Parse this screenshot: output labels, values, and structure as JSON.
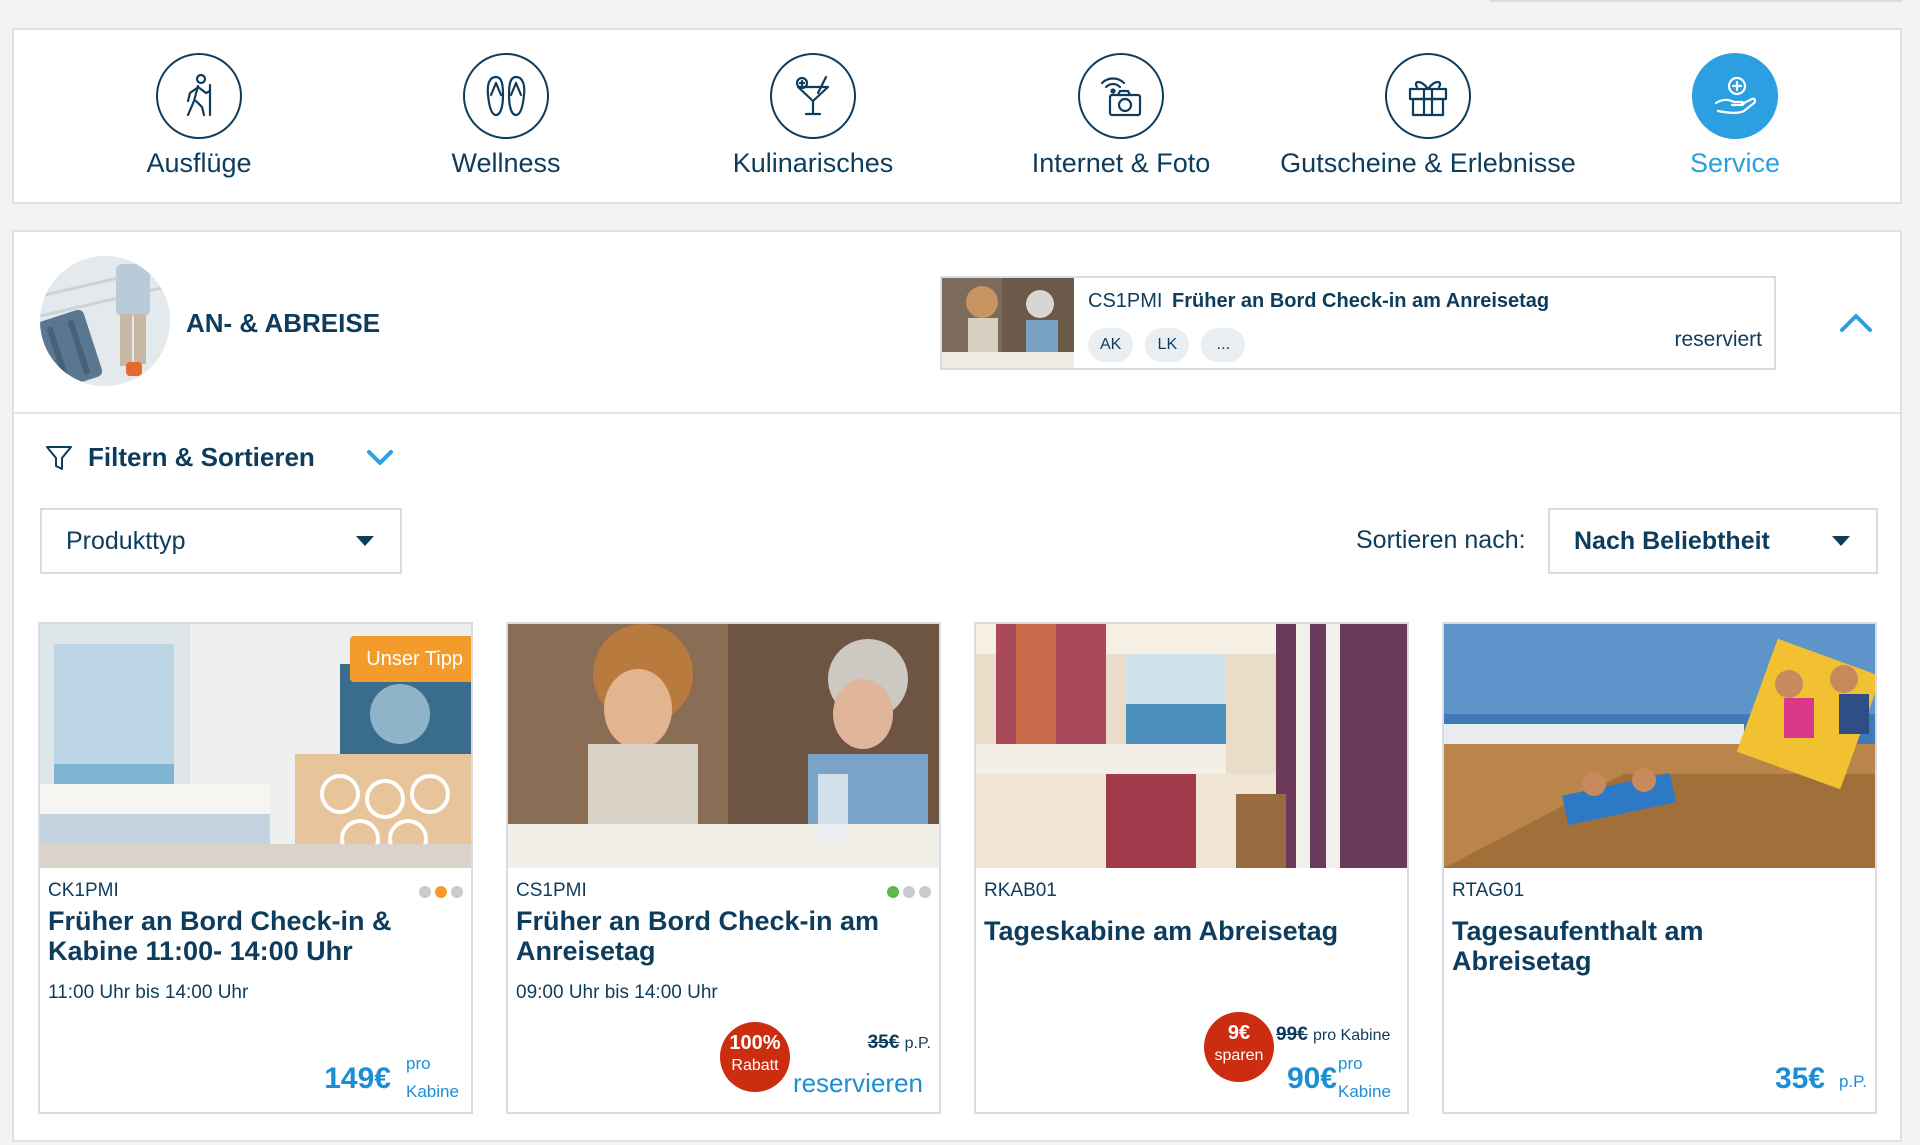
{
  "categories": [
    {
      "label": "Ausflüge",
      "icon": "hiker-icon",
      "active": false
    },
    {
      "label": "Wellness",
      "icon": "flip-flops-icon",
      "active": false
    },
    {
      "label": "Kulinarisches",
      "icon": "cocktail-icon",
      "active": false
    },
    {
      "label": "Internet & Foto",
      "icon": "wifi-camera-icon",
      "active": false
    },
    {
      "label": "Gutscheine & Erlebnisse",
      "icon": "gift-icon",
      "active": false
    },
    {
      "label": "Service",
      "icon": "hand-plus-icon",
      "active": true
    }
  ],
  "section": {
    "title": "AN- & ABREISE",
    "booked": {
      "code": "CS1PMI",
      "name": "Früher an Bord Check-in am Anreisetag",
      "tags": [
        "AK",
        "LK",
        "..."
      ],
      "status": "reserviert"
    }
  },
  "filter": {
    "label": "Filtern & Sortieren",
    "product_type": "Produkttyp",
    "sort_label": "Sortieren nach:",
    "sort_value": "Nach Beliebtheit"
  },
  "products": [
    {
      "code": "CK1PMI",
      "title": "Früher an Bord Check-in & Kabine 11:00- 14:00 Uhr",
      "time": "11:00 Uhr bis 14:00 Uhr",
      "tip": "Unser Tipp",
      "price": "149€",
      "unit_1": "pro",
      "unit_2": "Kabine"
    },
    {
      "code": "CS1PMI",
      "title": "Früher an Bord Check-in am Anreisetag",
      "time": "09:00 Uhr bis 14:00 Uhr",
      "badge_1": "100%",
      "badge_2": "Rabatt",
      "old_price": "35€",
      "old_unit": "p.P.",
      "action": "reservieren"
    },
    {
      "code": "RKAB01",
      "title": "Tageskabine am Abreisetag",
      "badge_1": "9€",
      "badge_2": "sparen",
      "old_price": "99€",
      "old_unit": "pro Kabine",
      "price": "90€",
      "unit_1": "pro",
      "unit_2": "Kabine"
    },
    {
      "code": "RTAG01",
      "title": "Tagesaufenthalt am Abreisetag",
      "price": "35€",
      "unit_1": "p.P."
    }
  ],
  "colors": {
    "navy": "#0d3c5c",
    "accent_blue": "#2c9fe0",
    "price_blue": "#1c8fd4",
    "tip_orange": "#f39c2b",
    "badge_red": "#cc2d10"
  }
}
